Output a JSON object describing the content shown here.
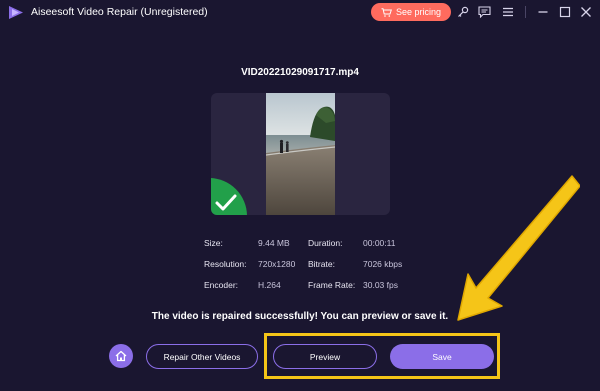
{
  "window": {
    "title": "Aiseesoft Video Repair (Unregistered)",
    "pricing_label": "See pricing"
  },
  "file": {
    "name": "VID20221029091717.mp4"
  },
  "info": {
    "size_label": "Size:",
    "size_value": "9.44 MB",
    "duration_label": "Duration:",
    "duration_value": "00:00:11",
    "resolution_label": "Resolution:",
    "resolution_value": "720x1280",
    "bitrate_label": "Bitrate:",
    "bitrate_value": "7026 kbps",
    "encoder_label": "Encoder:",
    "encoder_value": "H.264",
    "framerate_label": "Frame Rate:",
    "framerate_value": "30.03 fps"
  },
  "status": {
    "message": "The video is repaired successfully! You can preview or save it."
  },
  "actions": {
    "repair_other_label": "Repair Other Videos",
    "preview_label": "Preview",
    "save_label": "Save"
  },
  "colors": {
    "background": "#1a1630",
    "accent": "#8b6ee8",
    "pricing": "#ff6b5e",
    "success": "#22a04a",
    "annotation": "#f5c518"
  },
  "icons": {
    "logo": "aiseesoft-logo-icon",
    "cart": "cart-icon",
    "key": "key-icon",
    "feedback": "feedback-icon",
    "menu": "menu-icon",
    "minimize": "minimize-icon",
    "maximize": "maximize-icon",
    "close": "close-icon",
    "home": "home-icon",
    "check": "check-icon"
  }
}
